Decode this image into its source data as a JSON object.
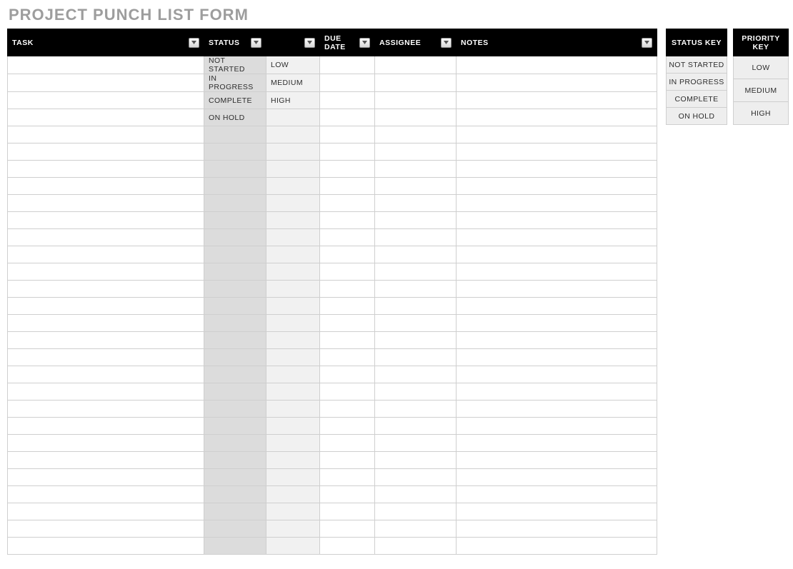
{
  "title": "PROJECT PUNCH LIST FORM",
  "columns": {
    "task": "TASK",
    "status": "STATUS",
    "priority": "",
    "due": "DUE DATE",
    "assignee": "ASSIGNEE",
    "notes": "NOTES"
  },
  "rows": [
    {
      "task": "",
      "status": "NOT STARTED",
      "priority": "LOW",
      "due": "",
      "assignee": "",
      "notes": ""
    },
    {
      "task": "",
      "status": "IN PROGRESS",
      "priority": "MEDIUM",
      "due": "",
      "assignee": "",
      "notes": ""
    },
    {
      "task": "",
      "status": "COMPLETE",
      "priority": "HIGH",
      "due": "",
      "assignee": "",
      "notes": ""
    },
    {
      "task": "",
      "status": "ON HOLD",
      "priority": "",
      "due": "",
      "assignee": "",
      "notes": ""
    },
    {
      "task": "",
      "status": "",
      "priority": "",
      "due": "",
      "assignee": "",
      "notes": ""
    },
    {
      "task": "",
      "status": "",
      "priority": "",
      "due": "",
      "assignee": "",
      "notes": ""
    },
    {
      "task": "",
      "status": "",
      "priority": "",
      "due": "",
      "assignee": "",
      "notes": ""
    },
    {
      "task": "",
      "status": "",
      "priority": "",
      "due": "",
      "assignee": "",
      "notes": ""
    },
    {
      "task": "",
      "status": "",
      "priority": "",
      "due": "",
      "assignee": "",
      "notes": ""
    },
    {
      "task": "",
      "status": "",
      "priority": "",
      "due": "",
      "assignee": "",
      "notes": ""
    },
    {
      "task": "",
      "status": "",
      "priority": "",
      "due": "",
      "assignee": "",
      "notes": ""
    },
    {
      "task": "",
      "status": "",
      "priority": "",
      "due": "",
      "assignee": "",
      "notes": ""
    },
    {
      "task": "",
      "status": "",
      "priority": "",
      "due": "",
      "assignee": "",
      "notes": ""
    },
    {
      "task": "",
      "status": "",
      "priority": "",
      "due": "",
      "assignee": "",
      "notes": ""
    },
    {
      "task": "",
      "status": "",
      "priority": "",
      "due": "",
      "assignee": "",
      "notes": ""
    },
    {
      "task": "",
      "status": "",
      "priority": "",
      "due": "",
      "assignee": "",
      "notes": ""
    },
    {
      "task": "",
      "status": "",
      "priority": "",
      "due": "",
      "assignee": "",
      "notes": ""
    },
    {
      "task": "",
      "status": "",
      "priority": "",
      "due": "",
      "assignee": "",
      "notes": ""
    },
    {
      "task": "",
      "status": "",
      "priority": "",
      "due": "",
      "assignee": "",
      "notes": ""
    },
    {
      "task": "",
      "status": "",
      "priority": "",
      "due": "",
      "assignee": "",
      "notes": ""
    },
    {
      "task": "",
      "status": "",
      "priority": "",
      "due": "",
      "assignee": "",
      "notes": ""
    },
    {
      "task": "",
      "status": "",
      "priority": "",
      "due": "",
      "assignee": "",
      "notes": ""
    },
    {
      "task": "",
      "status": "",
      "priority": "",
      "due": "",
      "assignee": "",
      "notes": ""
    },
    {
      "task": "",
      "status": "",
      "priority": "",
      "due": "",
      "assignee": "",
      "notes": ""
    },
    {
      "task": "",
      "status": "",
      "priority": "",
      "due": "",
      "assignee": "",
      "notes": ""
    },
    {
      "task": "",
      "status": "",
      "priority": "",
      "due": "",
      "assignee": "",
      "notes": ""
    },
    {
      "task": "",
      "status": "",
      "priority": "",
      "due": "",
      "assignee": "",
      "notes": ""
    },
    {
      "task": "",
      "status": "",
      "priority": "",
      "due": "",
      "assignee": "",
      "notes": ""
    },
    {
      "task": "",
      "status": "",
      "priority": "",
      "due": "",
      "assignee": "",
      "notes": ""
    }
  ],
  "status_key": {
    "header": "STATUS KEY",
    "items": [
      "NOT STARTED",
      "IN PROGRESS",
      "COMPLETE",
      "ON HOLD"
    ]
  },
  "priority_key": {
    "header": "PRIORITY KEY",
    "items": [
      "LOW",
      "MEDIUM",
      "HIGH"
    ]
  }
}
